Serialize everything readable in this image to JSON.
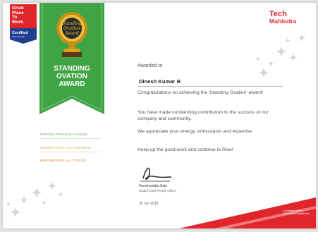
{
  "badge": {
    "line1": "Great",
    "line2": "Place",
    "line3": "To",
    "line4": "Work.",
    "certified": "Certified",
    "period": "2019-2020 IND"
  },
  "award": {
    "plaque_line1": "Standing",
    "plaque_line2": "Ovation",
    "plaque_line3": "Award",
    "title_line1": "STANDING",
    "title_line2": "OVATION",
    "title_line3": "AWARD"
  },
  "taglines": [
    "DRIVING POSITIVE CHANGE",
    "CELEBRATING EACH MOMENT",
    "EMPOWERING ALL TO RISE"
  ],
  "brand": {
    "line1": "Tech",
    "line2": "Mahindra",
    "corner_line1": "Connected World.",
    "corner_line2": "Connected Experiences."
  },
  "certificate": {
    "awarded_to": "Awarded to",
    "recipient": "Dinesh Kumar R",
    "congrats": "Congratulations on achieving the 'Standing Ovation' award!",
    "contribution": "You have made outstanding contribution to the success of our company and community.",
    "appreciation": "We appreciate your energy, enthusiasm and expertise.",
    "closing": "Keep up the good work and continue to Rise!",
    "signatory_name": "Harshvendra Soin",
    "signatory_title": "Global Chief People Officer",
    "date": "20 Jun 2019"
  },
  "colors": {
    "green": "#3ea444",
    "red": "#e0262b",
    "gold": "#d9a521",
    "navy": "#1e3f8f"
  }
}
